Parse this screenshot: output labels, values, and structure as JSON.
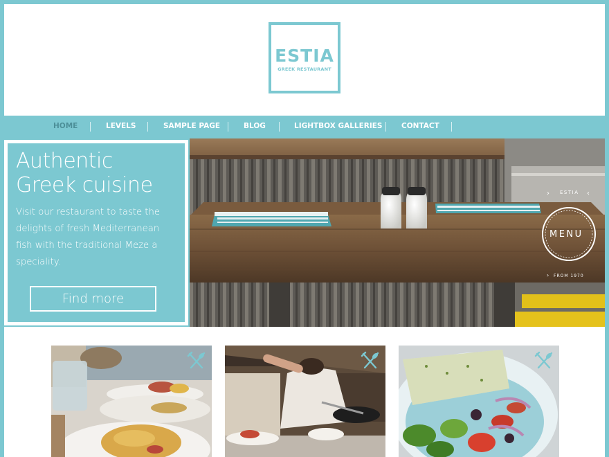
{
  "logo": {
    "title": "ESTIA",
    "subtitle": "GREEK RESTAURANT"
  },
  "nav": {
    "items": [
      {
        "label": "HOME",
        "active": true
      },
      {
        "label": "LEVELS",
        "active": false
      },
      {
        "label": "SAMPLE PAGE",
        "active": false
      },
      {
        "label": "BLOG",
        "active": false
      },
      {
        "label": "LIGHTBOX GALLERIES",
        "active": false
      },
      {
        "label": "CONTACT",
        "active": false
      }
    ]
  },
  "hero": {
    "title_line1": "Authentic",
    "title_line2": "Greek cuisine",
    "text": "Visit our restaurant to taste the delights of fresh Mediterranean fish with the traditional Meze a speciality.",
    "button_label": "Find more",
    "sign": {
      "top": "ESTIA",
      "center": "MENU",
      "bottom": "FROM 1970"
    }
  },
  "cards": [
    {
      "icon": "fork-knife-icon"
    },
    {
      "icon": "fork-knife-icon"
    },
    {
      "icon": "fork-knife-icon"
    }
  ],
  "colors": {
    "accent": "#7cc8d1",
    "active_nav": "#4c8f98",
    "white": "#ffffff"
  }
}
